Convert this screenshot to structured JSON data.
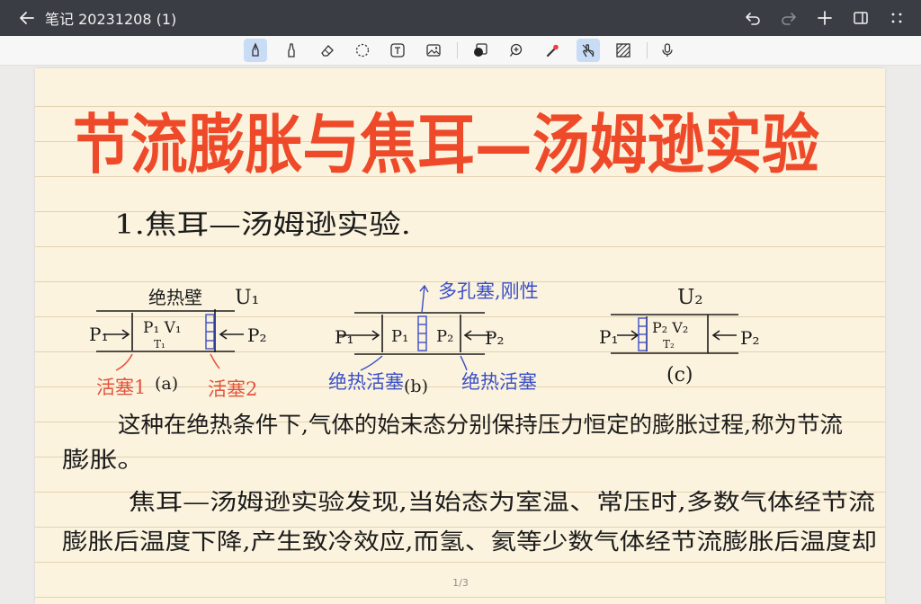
{
  "app": {
    "title": "笔记 20231208 (1)",
    "page_indicator": "1/3"
  },
  "top_actions": [
    "undo-icon",
    "redo-icon",
    "add-page-icon",
    "sidebar-icon",
    "more-icon"
  ],
  "toolbar": {
    "tools": [
      "pen-icon",
      "highlighter-icon",
      "eraser-icon",
      "lasso-icon",
      "text-box-icon",
      "image-icon",
      "shape-icon",
      "zoom-icon",
      "laser-pointer-icon",
      "hand-touch-icon",
      "pattern-icon",
      "microphone-icon"
    ],
    "active": [
      "pen-icon",
      "hand-touch-icon"
    ]
  },
  "colors": {
    "topbar": "#3b3d45",
    "title_ink": "#ee4a2a",
    "black_ink": "#1c1c1c",
    "blue_ink": "#3b4fc8",
    "red_ink": "#e4523a",
    "paper": "#fbf3de"
  },
  "note": {
    "heading": "节流膨胀与焦耳—汤姆逊实验",
    "section": "1.焦耳—汤姆逊实验.",
    "diagram_a": {
      "top_label": "绝热壁",
      "u_label": "U₁",
      "left_p": "P₁",
      "right_p": "P₂",
      "inner": "P₁ V₁",
      "inner_t": "T₁",
      "caption": "(a)",
      "label_left": "活塞1",
      "label_right": "活塞2"
    },
    "diagram_b": {
      "top_label": "多孔塞,刚性",
      "left_p": "P₁",
      "right_p": "P₂",
      "inner_left": "P₁",
      "inner_right": "P₂",
      "caption": "(b)",
      "label_left": "绝热活塞",
      "label_right": "绝热活塞"
    },
    "diagram_c": {
      "u_label": "U₂",
      "left_p": "P₁",
      "right_p": "P₂",
      "inner": "P₂ V₂",
      "inner_t": "T₂",
      "caption": "(c)"
    },
    "para1_line1": "这种在绝热条件下,气体的始末态分别保持压力恒定的膨胀过程,称为节流",
    "para1_line2": "膨胀。",
    "para2_line1": "焦耳—汤姆逊实验发现,当始态为室温、常压时,多数气体经节流",
    "para2_line2": "膨胀后温度下降,产生致冷效应,而氢、氦等少数气体经节流膨胀后温度却"
  }
}
